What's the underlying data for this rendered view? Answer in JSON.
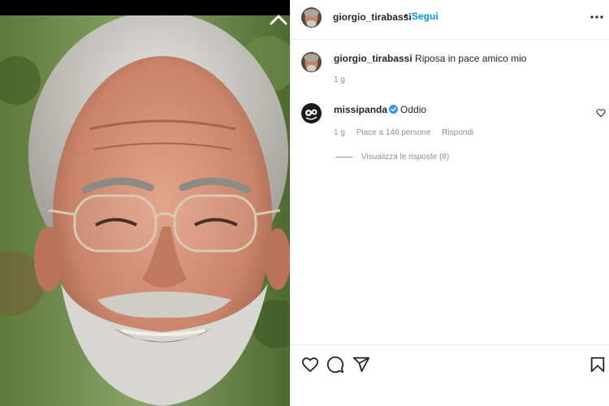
{
  "post": {
    "author": "giorgio_tirabassi",
    "dot": "•",
    "follow_label": "Segui"
  },
  "comments": [
    {
      "username": "giorgio_tirabassi",
      "text": "Riposa in pace amico mio",
      "time": "1 g"
    },
    {
      "username": "missipanda",
      "verified": true,
      "text": "Oddio",
      "time": "1 g",
      "likes": "Piace a 146 persone",
      "reply_label": "Rispondi",
      "view_replies": "Visualizza le risposte (8)"
    }
  ],
  "icons": {
    "close": "chevron-up-icon",
    "more": "more-horizontal-icon",
    "like": "heart-icon",
    "comment": "comment-icon",
    "share": "send-icon",
    "save": "bookmark-icon"
  },
  "colors": {
    "accent": "#0095f6",
    "verified": "#3897f0",
    "text": "#262626",
    "muted": "#8e8e8e"
  }
}
